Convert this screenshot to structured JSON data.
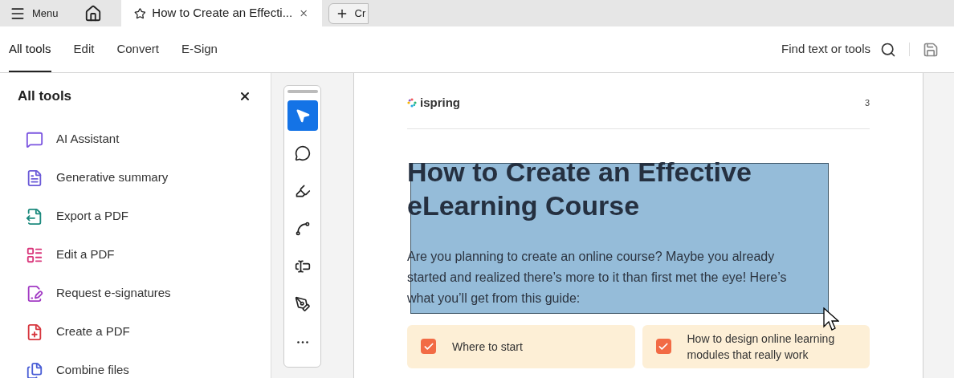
{
  "tabbar": {
    "menu": "Menu",
    "document_tab": "How to Create an Effecti...",
    "new_tab": "Cr"
  },
  "toolbar": {
    "tabs": [
      {
        "label": "All tools",
        "selected": true
      },
      {
        "label": "Edit",
        "selected": false
      },
      {
        "label": "Convert",
        "selected": false
      },
      {
        "label": "E-Sign",
        "selected": false
      }
    ],
    "search": "Find text or tools"
  },
  "sidebar": {
    "title": "All tools",
    "items": [
      {
        "label": "AI Assistant",
        "kind": "ai",
        "color": "#7b55e0"
      },
      {
        "label": "Generative summary",
        "kind": "summary",
        "color": "#6b5bd8"
      },
      {
        "label": "Export a PDF",
        "kind": "export",
        "color": "#1d8a7e"
      },
      {
        "label": "Edit a PDF",
        "kind": "edit",
        "color": "#d9357a"
      },
      {
        "label": "Request e-signatures",
        "kind": "sign",
        "color": "#a23bc4"
      },
      {
        "label": "Create a PDF",
        "kind": "create",
        "color": "#d7373f"
      },
      {
        "label": "Combine files",
        "kind": "combine",
        "color": "#4b5fd6"
      }
    ]
  },
  "rail": [
    {
      "kind": "select",
      "selected": true
    },
    {
      "kind": "comment",
      "selected": false
    },
    {
      "kind": "highlight",
      "selected": false
    },
    {
      "kind": "draw",
      "selected": false
    },
    {
      "kind": "textbox",
      "selected": false
    },
    {
      "kind": "sign",
      "selected": false
    },
    {
      "kind": "more",
      "selected": false
    }
  ],
  "page": {
    "logo": "ispring",
    "number": "3",
    "title": "How to Create an Effective eLearning Course",
    "intro": "Are you planning to create an online course? Maybe you already started and realized there’s more to it than first met the eye! Here’s what you’ll get from this guide:",
    "cards": [
      {
        "text": "Where to start",
        "checked": true
      },
      {
        "text": "How to design online learning modules that really work",
        "checked": true
      }
    ]
  }
}
